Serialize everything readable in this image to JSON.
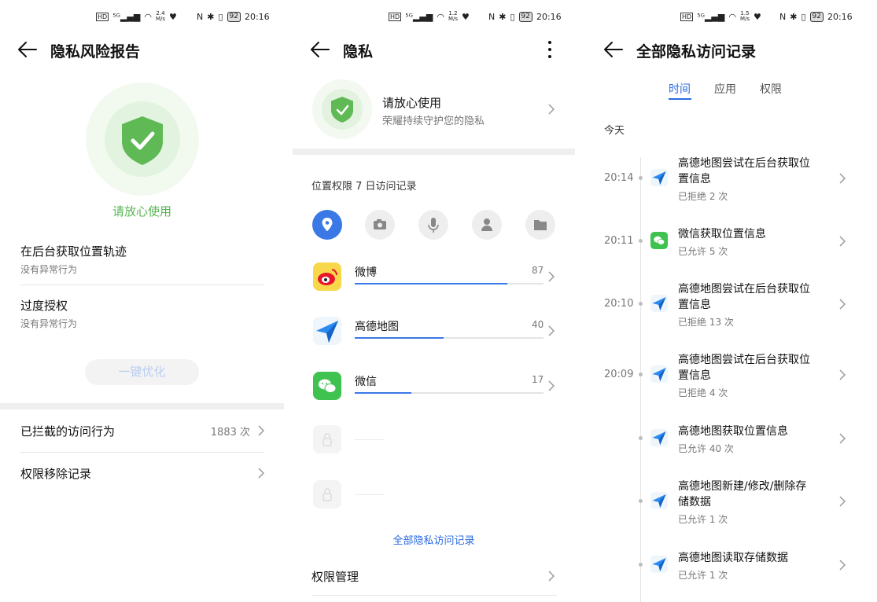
{
  "screen1": {
    "status": {
      "speed_top": "2.4",
      "speed_unit": "M/s",
      "battery": "92",
      "time": "20:16"
    },
    "title": "隐私风险报告",
    "hero_text": "请放心使用",
    "items": [
      {
        "title": "在后台获取位置轨迹",
        "sub": "没有异常行为"
      },
      {
        "title": "过度授权",
        "sub": "没有异常行为"
      }
    ],
    "optimize_button": "一键优化",
    "blocked_label": "已拦截的访问行为",
    "blocked_count": "1883 次",
    "removal_label": "权限移除记录",
    "colors": {
      "accent_green": "#58b452",
      "hero_ring": "#eef8ec"
    }
  },
  "screen2": {
    "status": {
      "speed_top": "1.2",
      "speed_unit": "M/s",
      "battery": "92",
      "time": "20:16"
    },
    "title": "隐私",
    "card_title": "请放心使用",
    "card_sub": "荣耀持续守护您的隐私",
    "section_title": "位置权限 7 日访问记录",
    "permission_icons": [
      "location-icon",
      "camera-icon",
      "microphone-icon",
      "contacts-icon",
      "folder-icon"
    ],
    "apps": [
      {
        "name": "微博",
        "count": "87",
        "fraction": 0.81
      },
      {
        "name": "高德地图",
        "count": "40",
        "fraction": 0.47
      },
      {
        "name": "微信",
        "count": "17",
        "fraction": 0.3
      }
    ],
    "all_records_link": "全部隐私访问记录",
    "perm_manage": "权限管理",
    "colors": {
      "accent_blue": "#3a78e6"
    }
  },
  "screen3": {
    "status": {
      "speed_top": "1.5",
      "speed_unit": "M/s",
      "battery": "92",
      "time": "20:16"
    },
    "title": "全部隐私访问记录",
    "tabs": [
      "时间",
      "应用",
      "权限"
    ],
    "active_tab": "时间",
    "day_label": "今天",
    "records": [
      {
        "time": "20:14",
        "app": "amap",
        "title1": "高德地图尝试在后台获取位",
        "title2": "置信息",
        "status": "已拒绝 2 次"
      },
      {
        "time": "20:11",
        "app": "wechat",
        "title1": "微信获取位置信息",
        "title2": "",
        "status": "已允许 5 次"
      },
      {
        "time": "20:10",
        "app": "amap",
        "title1": "高德地图尝试在后台获取位",
        "title2": "置信息",
        "status": "已拒绝 13 次"
      },
      {
        "time": "20:09",
        "app": "amap",
        "title1": "高德地图尝试在后台获取位",
        "title2": "置信息",
        "status": "已拒绝 4 次"
      },
      {
        "time": "",
        "app": "amap",
        "title1": "高德地图获取位置信息",
        "title2": "",
        "status": "已允许 40 次"
      },
      {
        "time": "",
        "app": "amap",
        "title1": "高德地图新建/修改/删除存",
        "title2": "储数据",
        "status": "已允许 1 次"
      },
      {
        "time": "",
        "app": "amap",
        "title1": "高德地图读取存储数据",
        "title2": "",
        "status": "已允许 1 次"
      }
    ]
  }
}
